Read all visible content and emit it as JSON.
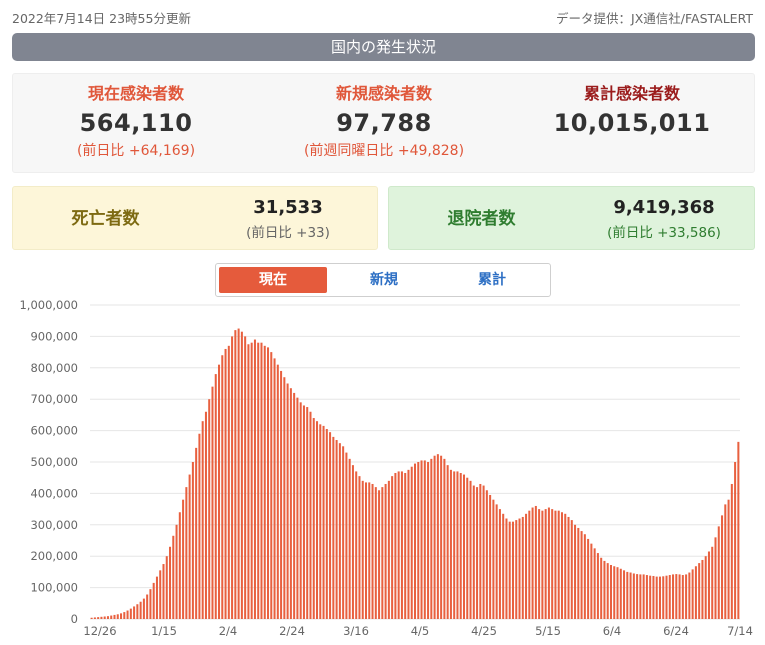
{
  "header": {
    "updated": "2022年7月14日 23時55分更新",
    "source": "データ提供：JX通信社/FASTALERT"
  },
  "banner": {
    "title": "国内の発生状況"
  },
  "stats": {
    "current": {
      "label": "現在感染者数",
      "value": "564,110",
      "diff": "(前日比 +64,169)"
    },
    "new": {
      "label": "新規感染者数",
      "value": "97,788",
      "diff": "(前週同曜日比 +49,828)"
    },
    "total": {
      "label": "累計感染者数",
      "value": "10,015,011"
    },
    "deaths": {
      "label": "死亡者数",
      "value": "31,533",
      "diff": "(前日比 +33)"
    },
    "recovered": {
      "label": "退院者数",
      "value": "9,419,368",
      "diff": "(前日比 +33,586)"
    }
  },
  "tabs": [
    {
      "label": "現在",
      "active": true
    },
    {
      "label": "新規",
      "active": false
    },
    {
      "label": "累計",
      "active": false
    }
  ],
  "colors": {
    "bar": "#e8603f",
    "accent": "#e55b3c",
    "link": "#2d6fc4",
    "grid": "#e6e6e6"
  },
  "chart_data": {
    "type": "bar",
    "title": "",
    "xlabel": "",
    "ylabel": "",
    "ylim": [
      0,
      1000000
    ],
    "y_ticks": [
      "0",
      "100,000",
      "200,000",
      "300,000",
      "400,000",
      "500,000",
      "600,000",
      "700,000",
      "800,000",
      "900,000",
      "1,000,000"
    ],
    "x_ticks": [
      "12/26",
      "1/15",
      "2/4",
      "2/24",
      "3/16",
      "4/5",
      "4/25",
      "5/15",
      "6/4",
      "6/24",
      "7/14"
    ],
    "grid": true,
    "date_start": "12/26",
    "date_end": "7/14",
    "values": [
      4000,
      5000,
      6000,
      7000,
      8000,
      9000,
      11000,
      13000,
      15000,
      18000,
      22000,
      27000,
      33000,
      40000,
      47000,
      55000,
      65000,
      78000,
      95000,
      115000,
      135000,
      155000,
      175000,
      200000,
      230000,
      265000,
      300000,
      340000,
      380000,
      420000,
      460000,
      500000,
      545000,
      590000,
      630000,
      660000,
      700000,
      740000,
      780000,
      810000,
      840000,
      860000,
      870000,
      900000,
      920000,
      925000,
      915000,
      900000,
      875000,
      880000,
      890000,
      880000,
      880000,
      870000,
      865000,
      850000,
      830000,
      810000,
      790000,
      770000,
      750000,
      735000,
      720000,
      705000,
      690000,
      680000,
      675000,
      660000,
      640000,
      630000,
      620000,
      615000,
      605000,
      595000,
      580000,
      570000,
      560000,
      550000,
      530000,
      510000,
      490000,
      470000,
      455000,
      440000,
      435000,
      435000,
      430000,
      420000,
      410000,
      420000,
      430000,
      440000,
      455000,
      465000,
      470000,
      470000,
      465000,
      475000,
      485000,
      495000,
      500000,
      505000,
      505000,
      500000,
      510000,
      520000,
      525000,
      520000,
      510000,
      490000,
      475000,
      470000,
      470000,
      465000,
      460000,
      450000,
      440000,
      425000,
      420000,
      430000,
      425000,
      410000,
      395000,
      380000,
      365000,
      350000,
      335000,
      320000,
      310000,
      310000,
      315000,
      320000,
      325000,
      335000,
      345000,
      355000,
      360000,
      350000,
      345000,
      350000,
      355000,
      350000,
      345000,
      345000,
      340000,
      335000,
      325000,
      315000,
      300000,
      290000,
      280000,
      270000,
      255000,
      240000,
      225000,
      210000,
      195000,
      185000,
      178000,
      172000,
      168000,
      165000,
      160000,
      155000,
      150000,
      148000,
      145000,
      143000,
      142000,
      142000,
      140000,
      138000,
      137000,
      135000,
      135000,
      136000,
      138000,
      140000,
      142000,
      143000,
      142000,
      140000,
      142000,
      148000,
      158000,
      168000,
      178000,
      188000,
      200000,
      215000,
      230000,
      260000,
      295000,
      330000,
      365000,
      380000,
      430000,
      500000,
      564110
    ]
  }
}
